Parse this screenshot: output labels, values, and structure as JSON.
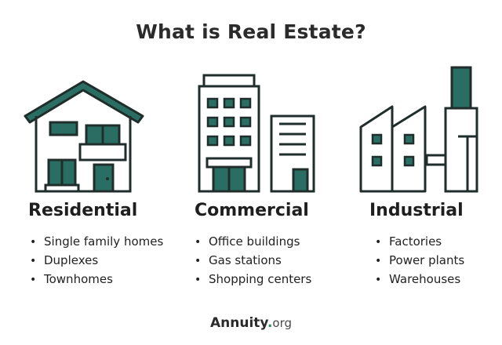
{
  "title": "What is Real Estate?",
  "colors": {
    "accent": "#2a6e63",
    "outline": "#1f2d2b",
    "text": "#222222",
    "brand_dot": "#2e8b57"
  },
  "categories": [
    {
      "icon": "house-icon",
      "heading": "Residential",
      "items": [
        "Single family homes",
        "Duplexes",
        "Townhomes"
      ]
    },
    {
      "icon": "office-buildings-icon",
      "heading": "Commercial",
      "items": [
        "Office buildings",
        "Gas stations",
        "Shopping centers"
      ]
    },
    {
      "icon": "factory-icon",
      "heading": "Industrial",
      "items": [
        "Factories",
        "Power plants",
        "Warehouses"
      ]
    }
  ],
  "brand": {
    "name": "Annuity",
    "separator": ".",
    "suffix": "org"
  }
}
